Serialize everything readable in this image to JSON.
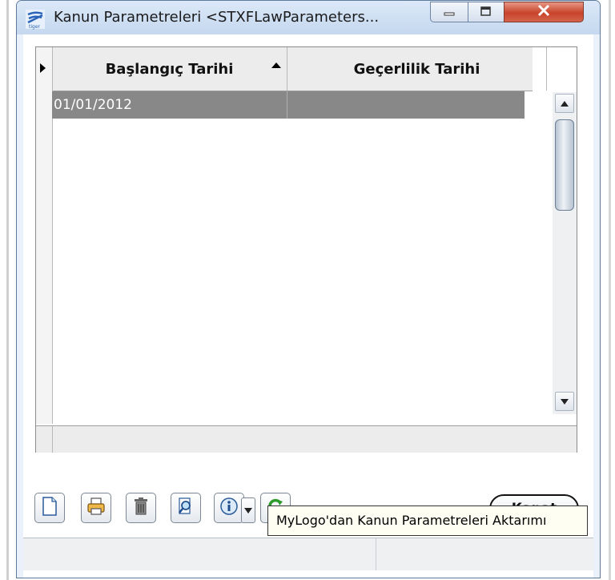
{
  "window": {
    "title": "Kanun Parametreleri <STXFLawParameters..."
  },
  "grid": {
    "columns": [
      "Başlangıç Tarihi",
      "Geçerlilik Tarihi"
    ],
    "rows": [
      {
        "start_date": "01/01/2012",
        "valid_date": ""
      }
    ]
  },
  "buttons": {
    "close_label_underlined": "K",
    "close_label_rest": "apat"
  },
  "tooltip": {
    "text": "MyLogo'dan Kanun Parametreleri Aktarımı"
  },
  "icons": {
    "app": "logo-icon",
    "new": "new-document-icon",
    "print": "print-icon",
    "delete": "trash-icon",
    "search": "magnifier-icon",
    "info": "info-icon",
    "dropdown": "caret-down-icon",
    "sync": "refresh-icon"
  },
  "colors": {
    "selected_row": "#888888",
    "titlebar": "#c5d8ef",
    "close_red": "#c8442b"
  }
}
